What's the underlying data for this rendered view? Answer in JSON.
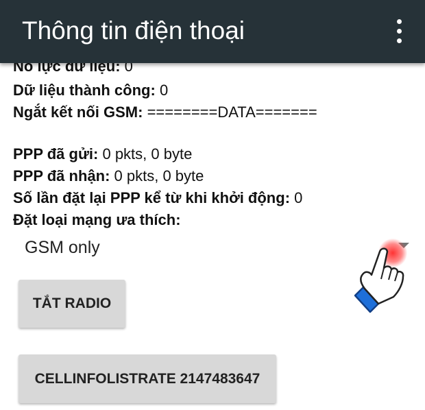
{
  "app_bar": {
    "title": "Thông tin điện thoại",
    "menu_icon": "more-vert-icon"
  },
  "info_rows": [
    {
      "label": "Nỗ lực dữ liệu:",
      "value": "0"
    },
    {
      "label": "Dữ liệu thành công:",
      "value": "0"
    },
    {
      "label": "Ngắt kết nối GSM:",
      "value": "========DATA======="
    },
    {
      "label": "PPP đã gửi:",
      "value": "0 pkts, 0 byte"
    },
    {
      "label": "PPP đã nhận:",
      "value": "0 pkts, 0 byte"
    },
    {
      "label": "Số lần đặt lại PPP kể từ khi khởi động:",
      "value": "0"
    },
    {
      "label": "Đặt loại mạng ưa thích:",
      "value": ""
    }
  ],
  "network_type_spinner": {
    "selected": "GSM only",
    "arrow_icon": "dropdown-arrow-icon"
  },
  "buttons": {
    "radio_off": "TẮT RADIO",
    "cellinfo": "CELLINFOLISTRATE 2147483647"
  },
  "overlay": {
    "tap_indicator_icon": "tap-hand-icon",
    "tap_color": "#ff3b3b"
  },
  "colors": {
    "app_bar": "#263238",
    "button_bg": "#d8d8d8"
  }
}
